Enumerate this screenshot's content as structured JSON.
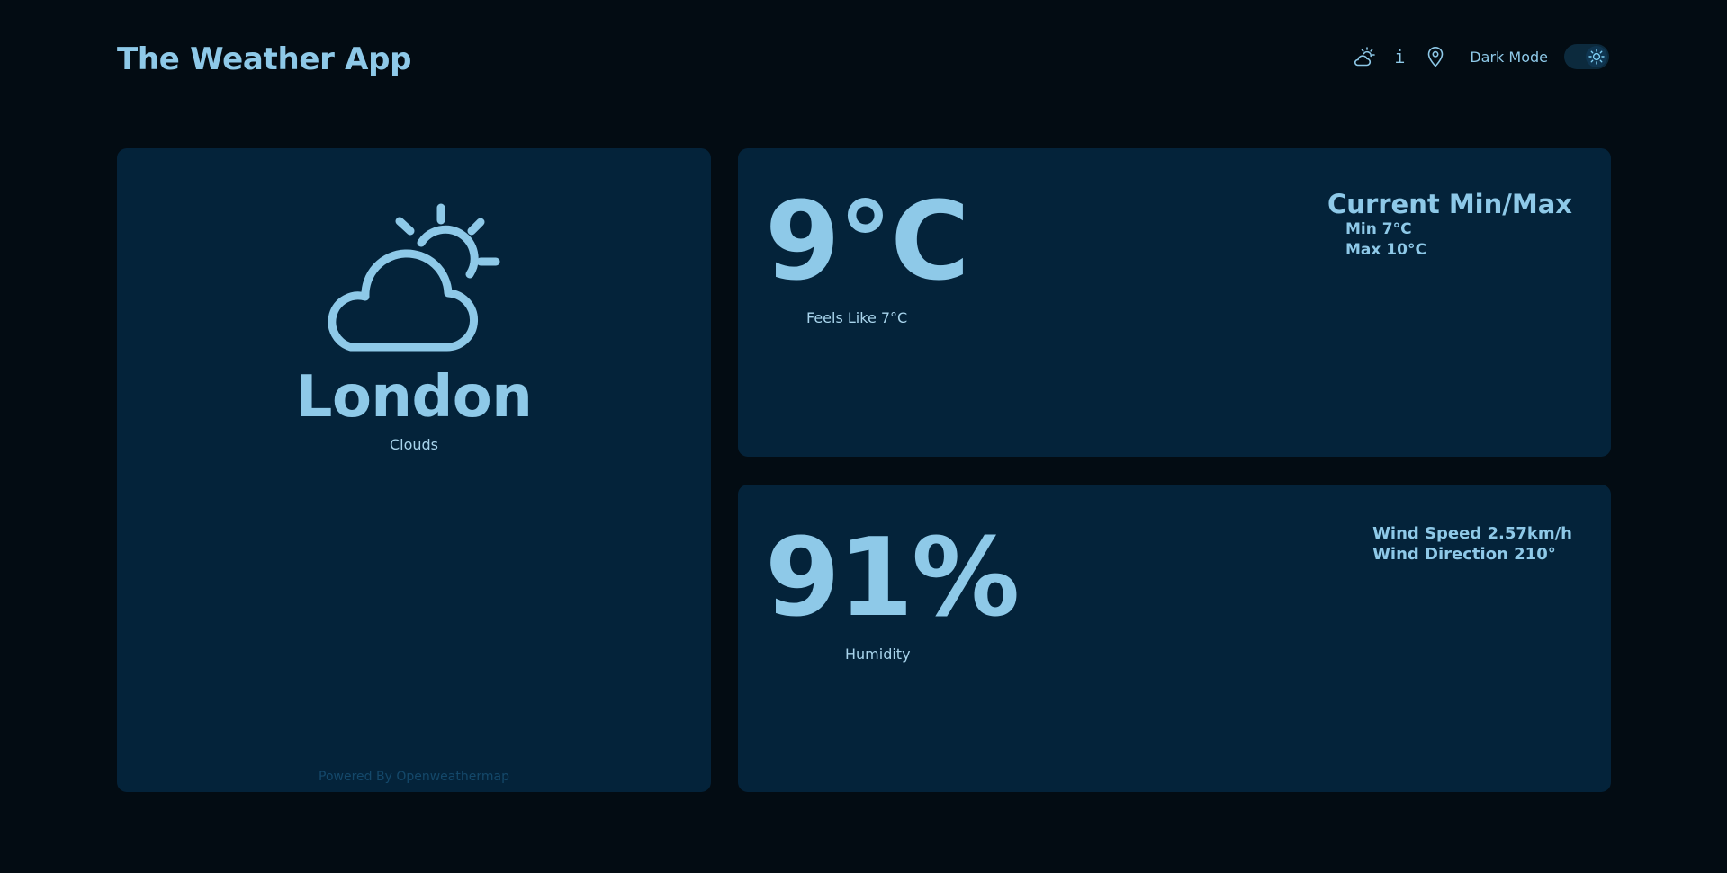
{
  "header": {
    "title": "The Weather App",
    "mode_label": "Dark Mode",
    "info_glyph": "i",
    "icons": [
      "cloud-sun-icon",
      "info-icon",
      "location-pin-icon",
      "sun-icon"
    ],
    "dark_mode_enabled": true
  },
  "location_card": {
    "city": "London",
    "condition": "Clouds",
    "weather_icon": "cloud-sun-icon",
    "powered_by": "Powered By Openweathermap"
  },
  "temperature_card": {
    "temp": "9°C",
    "feels_like": "Feels Like 7°C",
    "minmax_title": "Current Min/Max",
    "min": "Min 7°C",
    "max": "Max 10°C"
  },
  "humidity_card": {
    "humidity": "91%",
    "humidity_label": "Humidity",
    "wind_speed": "Wind Speed 2.57km/h",
    "wind_direction": "Wind Direction 210°"
  },
  "colors": {
    "background": "#030c13",
    "card": "#04233a",
    "accent": "#8ec9e8",
    "muted_link": "#14486a"
  }
}
